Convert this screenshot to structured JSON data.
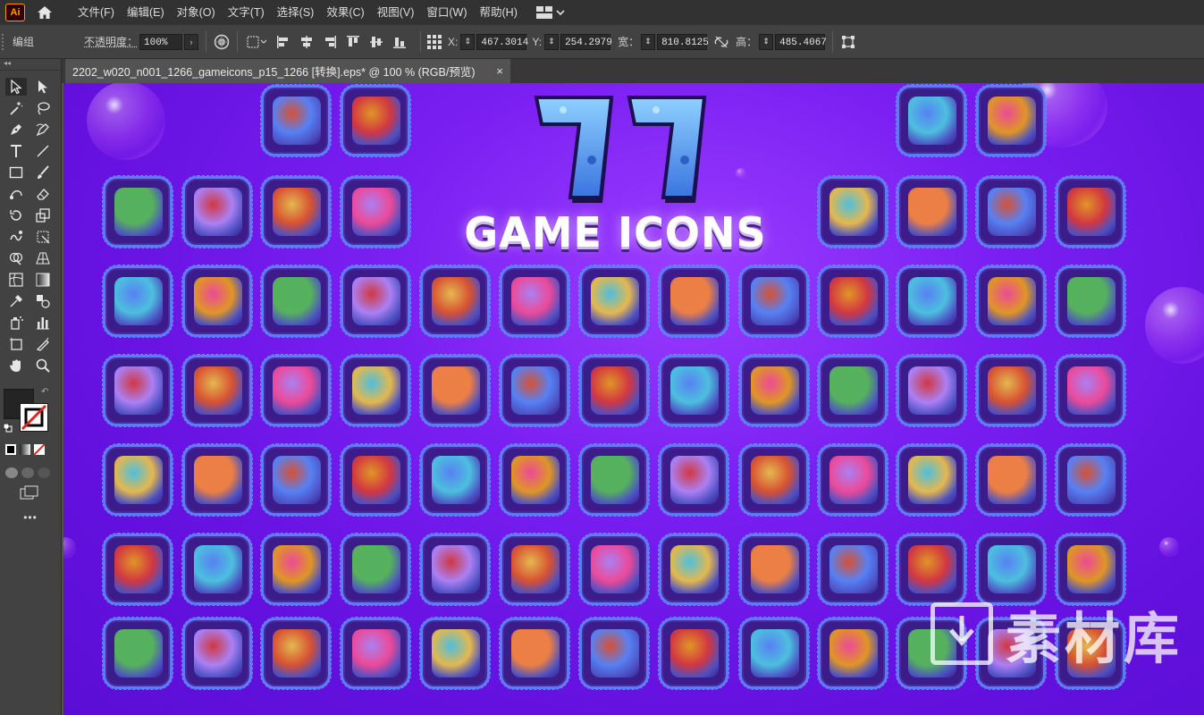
{
  "app": {
    "logo_text": "Ai"
  },
  "menu": [
    "文件(F)",
    "编辑(E)",
    "对象(O)",
    "文字(T)",
    "选择(S)",
    "效果(C)",
    "视图(V)",
    "窗口(W)",
    "帮助(H)"
  ],
  "control_bar": {
    "selection_label": "编组",
    "opacity_label": "不透明度：",
    "opacity_value": "100%",
    "x_label": "X:",
    "x_value": "467.3014",
    "y_label": "Y:",
    "y_value": "254.2979",
    "w_label": "宽：",
    "w_value": "810.8125",
    "h_label": "高：",
    "h_value": "485.4067"
  },
  "document": {
    "tab_title": "2202_w020_n001_1266_gameicons_p15_1266  [转换].eps* @ 100 % (RGB/预览)",
    "close_glyph": "×"
  },
  "artwork": {
    "headline_number": "77",
    "headline_text": "GAME ICONS"
  },
  "watermark": {
    "text": "素材库"
  },
  "toolbar": {
    "collapse_glyph": "◂◂",
    "more_glyph": "•••"
  },
  "colors": {
    "canvas_purple": "#7a1ff2",
    "cell_fill": "#3b1c8a",
    "selection_blue": "#5c7cf5",
    "ui_dark": "#323232"
  }
}
